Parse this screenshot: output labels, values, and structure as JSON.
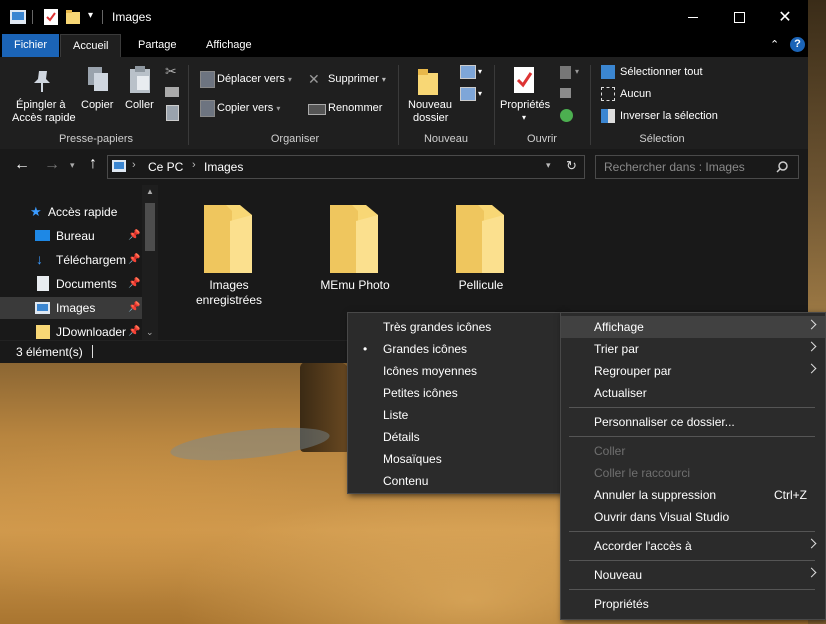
{
  "window": {
    "title": "Images"
  },
  "tabs": [
    "Fichier",
    "Accueil",
    "Partage",
    "Affichage"
  ],
  "ribbon": {
    "pin_line1": "Épingler à",
    "pin_line2": "Accès rapide",
    "copy": "Copier",
    "paste": "Coller",
    "group_clipboard": "Presse-papiers",
    "move_to": "Déplacer vers",
    "copy_to": "Copier vers",
    "delete": "Supprimer",
    "rename": "Renommer",
    "group_organize": "Organiser",
    "new_folder_line1": "Nouveau",
    "new_folder_line2": "dossier",
    "group_new": "Nouveau",
    "properties": "Propriétés",
    "group_open": "Ouvrir",
    "select_all": "Sélectionner tout",
    "select_none": "Aucun",
    "invert_selection": "Inverser la sélection",
    "group_select": "Sélection"
  },
  "address": {
    "crumb1": "Ce PC",
    "crumb2": "Images",
    "search_placeholder": "Rechercher dans : Images"
  },
  "nav": {
    "quick_access": "Accès rapide",
    "items": [
      {
        "label": "Bureau"
      },
      {
        "label": "Téléchargements"
      },
      {
        "label": "Documents"
      },
      {
        "label": "Images"
      },
      {
        "label": "JDownloader"
      }
    ]
  },
  "folders": [
    {
      "line1": "Images",
      "line2": "enregistrées"
    },
    {
      "line1": "MEmu Photo",
      "line2": ""
    },
    {
      "line1": "Pellicule",
      "line2": ""
    }
  ],
  "status": {
    "count": "3 élément(s)"
  },
  "view_menu": {
    "items": [
      "Très grandes icônes",
      "Grandes icônes",
      "Icônes moyennes",
      "Petites icônes",
      "Liste",
      "Détails",
      "Mosaïques",
      "Contenu"
    ],
    "selected": "Grandes icônes",
    "bullet": "•"
  },
  "context_menu": {
    "view": "Affichage",
    "sort_by": "Trier par",
    "group_by": "Regrouper par",
    "refresh": "Actualiser",
    "customize": "Personnaliser ce dossier...",
    "paste": "Coller",
    "paste_shortcut": "Coller le raccourci",
    "undo_delete": "Annuler la suppression",
    "undo_shortcut": "Ctrl+Z",
    "open_vs": "Ouvrir dans Visual Studio",
    "give_access": "Accorder l'accès à",
    "new": "Nouveau",
    "properties": "Propriétés"
  },
  "colors": {
    "accent": "#1b64b7",
    "folder": "#f8d775",
    "folder_dark": "#e8b84a"
  }
}
